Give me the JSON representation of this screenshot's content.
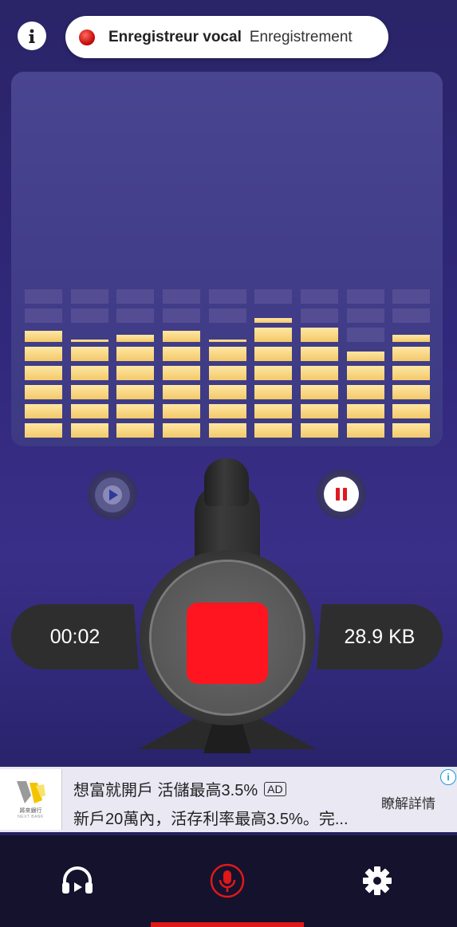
{
  "header": {
    "info_icon": "info-icon",
    "app_name": "Enregistreur vocal",
    "mode": "Enregistrement",
    "status_icon": "recording-dot-icon"
  },
  "equalizer": {
    "levels": [
      0.7,
      0.63,
      0.67,
      0.7,
      0.63,
      0.78,
      0.74,
      0.56,
      0.67
    ],
    "active_color": "#f7d27c",
    "inactive_color": "#5d5896"
  },
  "controls": {
    "play_icon": "play-icon",
    "pause_icon": "pause-icon",
    "stop_icon": "stop-icon",
    "stop_color": "#ff1520",
    "elapsed_time": "00:02",
    "file_size": "28.9 KB"
  },
  "ad": {
    "logo_icon": "next-bank-logo",
    "logo_text": "將來銀行",
    "logo_subtext": "NEXT BANK",
    "title": "想富就開戶 活儲最高3.5%",
    "badge": "AD",
    "description": "新戶20萬內，活存利率最高3.5%。完...",
    "cta": "瞭解詳情",
    "info_icon": "ad-info-icon"
  },
  "bottom_nav": {
    "items": [
      {
        "icon": "headphones-play-icon",
        "active": false
      },
      {
        "icon": "microphone-icon",
        "active": true
      },
      {
        "icon": "gear-icon",
        "active": false
      }
    ],
    "active_color": "#e01818"
  }
}
